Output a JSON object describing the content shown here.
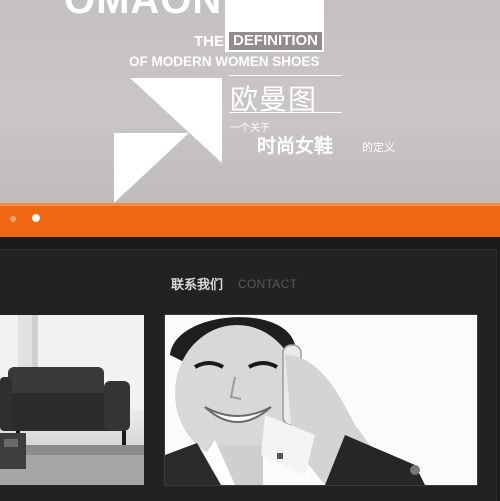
{
  "hero": {
    "brand": "OMAONY'S",
    "the": "THE",
    "definition": "DEFINITION",
    "subtitle": "OF MODERN WOMEN SHOES",
    "cn_title": "欧曼图",
    "cn_small": "一个关于",
    "cn_big": "时尚女鞋",
    "cn_tail": "的定义"
  },
  "slider": {
    "active_index": 2,
    "count": 2
  },
  "contact": {
    "title": "联系我们",
    "subtitle": "CONTACT"
  },
  "colors": {
    "accent": "#ef6613",
    "hero_bg": "#c6c3c2",
    "page_bg": "#1d1d1d"
  }
}
